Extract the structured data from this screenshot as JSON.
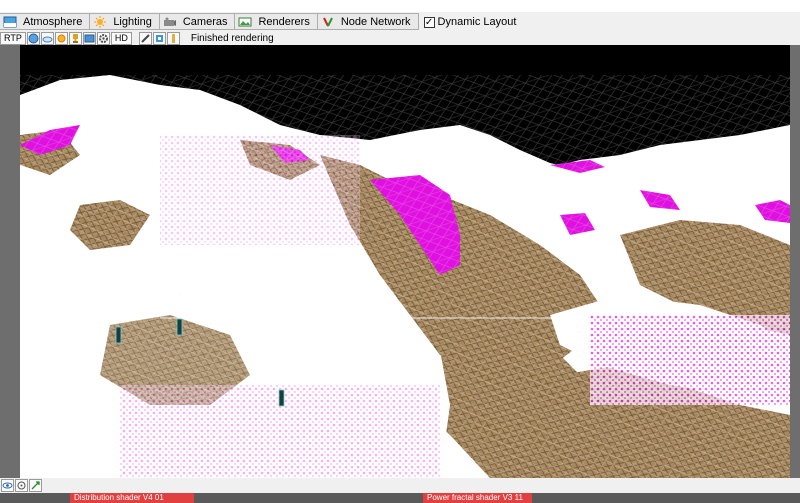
{
  "tabs": [
    {
      "label": "Atmosphere",
      "icon": "atmosphere-icon"
    },
    {
      "label": "Lighting",
      "icon": "sun-icon"
    },
    {
      "label": "Cameras",
      "icon": "camera-icon"
    },
    {
      "label": "Renderers",
      "icon": "renderer-icon"
    },
    {
      "label": "Node Network",
      "icon": "node-network-icon"
    }
  ],
  "dynamic_layout": {
    "label": "Dynamic Layout",
    "checked": true,
    "check_glyph": "✓"
  },
  "toolbar": {
    "rtp_label": "RTP",
    "hd_label": "HD",
    "status": "Finished rendering",
    "icons": [
      "sphere-icon",
      "cloud-icon",
      "gear-sun-icon",
      "trophy-icon",
      "image-icon",
      "gear-icon"
    ],
    "tool_icons": [
      "brush-icon",
      "crop-icon",
      "info-icon"
    ]
  },
  "bottom_buttons": [
    "eye-icon",
    "move-icon",
    "expand-icon"
  ],
  "node_strip": {
    "left": "Distribution shader V4 01",
    "right": "Power fractal shader V3 11"
  },
  "colors": {
    "sky": "#000000",
    "snow": "#ffffff",
    "rock": "#a6875e",
    "distribution_highlight": "#e011e0",
    "panel": "#f0f0f0",
    "viewport_frame": "#6e6e6e",
    "node_red": "#e04040"
  }
}
